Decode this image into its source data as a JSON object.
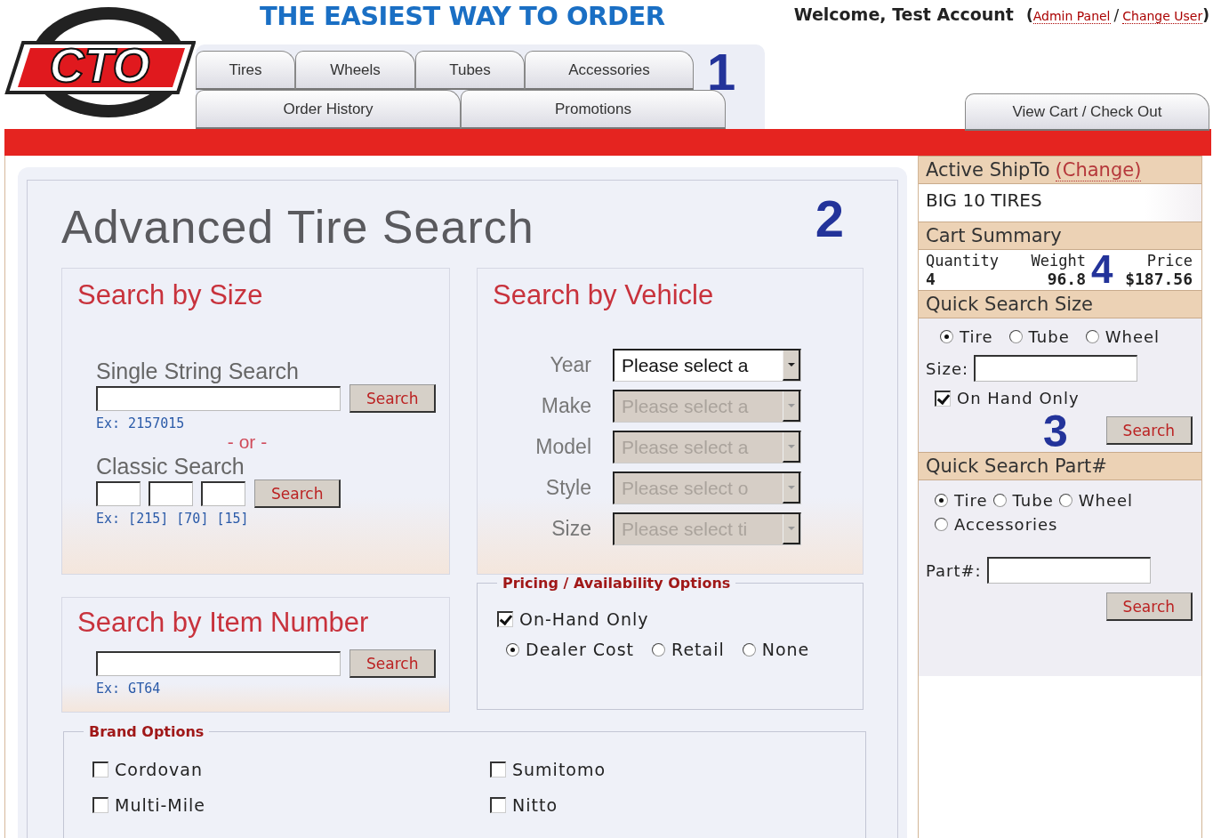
{
  "header": {
    "logo": "CTO",
    "tagline": "THE EASIEST WAY TO ORDER",
    "welcome": "Welcome, Test Account",
    "link_open": "(",
    "link_separator": "/",
    "link_close": ")",
    "account_links": [
      {
        "label": "Admin Panel"
      },
      {
        "label": "Change User"
      }
    ]
  },
  "nav": {
    "callout": "1",
    "tab_rows": [
      [
        {
          "label": "Tires",
          "selected": false
        },
        {
          "label": "Wheels",
          "selected": false
        },
        {
          "label": "Tubes",
          "selected": false
        },
        {
          "label": "Accessories",
          "selected": false
        }
      ],
      [
        {
          "label": "Order History",
          "selected": false
        },
        {
          "label": "Promotions",
          "selected": false
        }
      ]
    ],
    "cart_tab": {
      "label": "View Cart / Check Out",
      "selected": false
    }
  },
  "search": {
    "title": "Advanced Tire Search",
    "callout": "2",
    "by_size": {
      "title": "Search by Size",
      "single_label": "Single String Search",
      "single_button": "Search",
      "single_example": "Ex: 2157015",
      "or": "- or -",
      "classic_label": "Classic Search",
      "classic_button": "Search",
      "classic_example": "Ex: [215] [70] [15]"
    },
    "by_vehicle": {
      "title": "Search by Vehicle",
      "fields": [
        {
          "label": "Year",
          "value": "Please select a",
          "disabled": false
        },
        {
          "label": "Make",
          "value": "Please select a",
          "disabled": true
        },
        {
          "label": "Model",
          "value": "Please select a",
          "disabled": true
        },
        {
          "label": "Style",
          "value": "Please select o",
          "disabled": true
        },
        {
          "label": "Size",
          "value": "Please select ti",
          "disabled": true
        }
      ]
    },
    "by_item": {
      "title": "Search by Item Number",
      "button": "Search",
      "example": "Ex: GT64"
    },
    "pricing": {
      "legend": "Pricing / Availability Options",
      "on_hand": {
        "label": "On-Hand Only",
        "checked": true
      },
      "price_options": [
        {
          "label": "Dealer Cost",
          "selected": true
        },
        {
          "label": "Retail",
          "selected": false
        },
        {
          "label": "None",
          "selected": false
        }
      ]
    },
    "brands": {
      "legend": "Brand Options",
      "items": [
        {
          "label": "Cordovan",
          "checked": false
        },
        {
          "label": "Sumitomo",
          "checked": false
        },
        {
          "label": "Multi-Mile",
          "checked": false
        },
        {
          "label": "Nitto",
          "checked": false
        }
      ]
    }
  },
  "sidebar": {
    "ship_to": {
      "heading": "Active ShipTo",
      "link": "(Change)",
      "value": "BIG 10 TIRES"
    },
    "cart_summary": {
      "heading": "Cart Summary",
      "callout": "4",
      "columns": [
        {
          "label": "Quantity",
          "value": "4"
        },
        {
          "label": "Weight",
          "value": "96.8"
        },
        {
          "label": "Price",
          "value": "$187.56"
        }
      ]
    },
    "quick_size": {
      "heading": "Quick Search Size",
      "callout": "3",
      "types": [
        {
          "label": "Tire",
          "selected": true
        },
        {
          "label": "Tube",
          "selected": false
        },
        {
          "label": "Wheel",
          "selected": false
        }
      ],
      "size_label": "Size:",
      "on_hand": {
        "label": "On Hand Only",
        "checked": true
      },
      "button": "Search"
    },
    "quick_part": {
      "heading": "Quick Search Part#",
      "types": [
        {
          "label": "Tire",
          "selected": true
        },
        {
          "label": "Tube",
          "selected": false
        },
        {
          "label": "Wheel",
          "selected": false
        },
        {
          "label": "Accessories",
          "selected": false
        }
      ],
      "part_label": "Part#:",
      "button": "Search"
    }
  }
}
